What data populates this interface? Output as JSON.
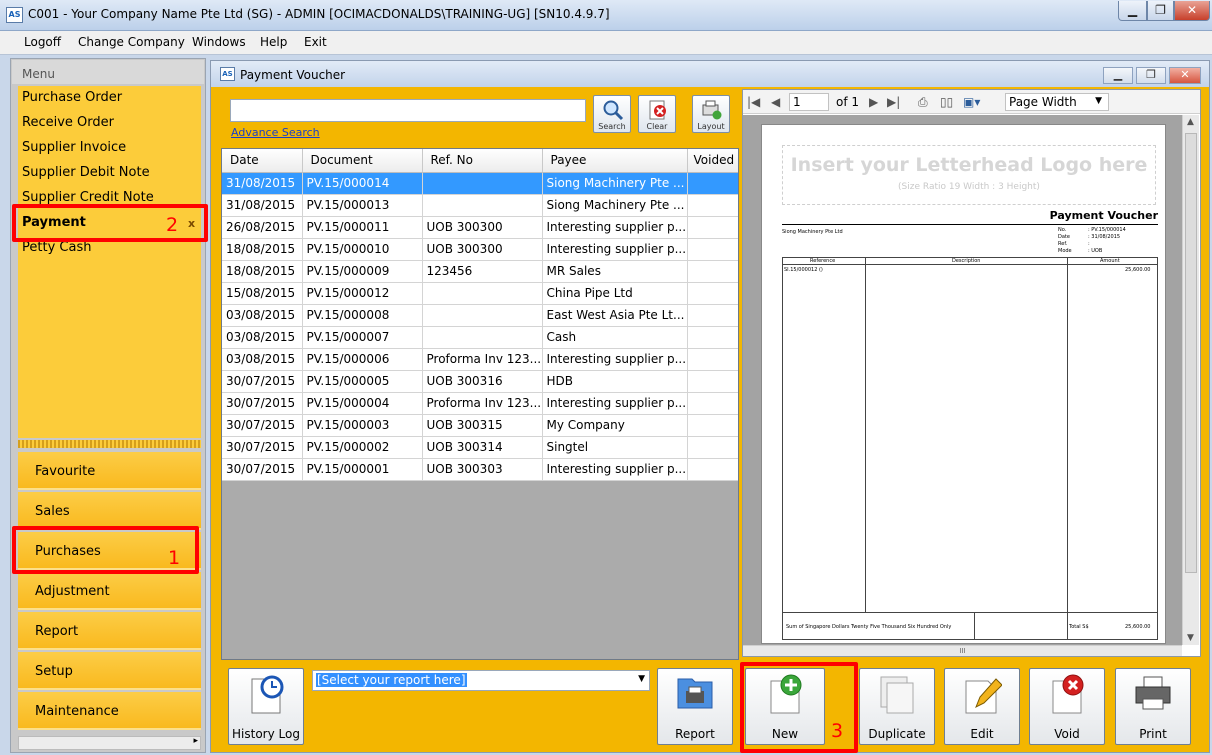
{
  "window": {
    "title": "C001 - Your Company Name Pte Ltd (SG) - ADMIN [OCIMACDONALDS\\TRAINING-UG] [SN10.4.9.7]",
    "icon": "AS"
  },
  "menubar": [
    "Logoff",
    "Change Company",
    "Windows",
    "Help",
    "Exit"
  ],
  "sidebar": {
    "header": "Menu",
    "items": [
      "Purchase Order",
      "Receive Order",
      "Supplier Invoice",
      "Supplier Debit Note",
      "Supplier Credit Note",
      "Payment",
      "Petty Cash"
    ],
    "active_close": "x",
    "categories": [
      "Favourite",
      "Sales",
      "Purchases",
      "Adjustment",
      "Report",
      "Setup",
      "Maintenance"
    ],
    "scroll_glyph": "▸"
  },
  "doc": {
    "title": "Payment Voucher",
    "icon": "AS",
    "advance_search": "Advance Search",
    "buttons": {
      "search": "Search",
      "clear": "Clear",
      "layout": "Layout"
    }
  },
  "grid": {
    "columns": [
      "Date",
      "Document",
      "Ref. No",
      "Payee",
      "Voided"
    ],
    "rows": [
      [
        "31/08/2015",
        "PV.15/000014",
        "",
        "Siong Machinery Pte ...",
        ""
      ],
      [
        "31/08/2015",
        "PV.15/000013",
        "",
        "Siong Machinery Pte ...",
        ""
      ],
      [
        "26/08/2015",
        "PV.15/000011",
        "UOB 300300",
        "Interesting supplier p...",
        ""
      ],
      [
        "18/08/2015",
        "PV.15/000010",
        "UOB 300300",
        "Interesting supplier p...",
        ""
      ],
      [
        "18/08/2015",
        "PV.15/000009",
        "123456",
        "MR Sales",
        ""
      ],
      [
        "15/08/2015",
        "PV.15/000012",
        "",
        "China Pipe Ltd",
        ""
      ],
      [
        "03/08/2015",
        "PV.15/000008",
        "",
        "East West Asia Pte Lt...",
        ""
      ],
      [
        "03/08/2015",
        "PV.15/000007",
        "",
        "Cash",
        ""
      ],
      [
        "03/08/2015",
        "PV.15/000006",
        "Proforma Inv 123...",
        "Interesting supplier p...",
        ""
      ],
      [
        "30/07/2015",
        "PV.15/000005",
        "UOB 300316",
        "HDB",
        ""
      ],
      [
        "30/07/2015",
        "PV.15/000004",
        "Proforma Inv 123...",
        "Interesting supplier p...",
        ""
      ],
      [
        "30/07/2015",
        "PV.15/000003",
        "UOB 300315",
        "My Company",
        ""
      ],
      [
        "30/07/2015",
        "PV.15/000002",
        "UOB 300314",
        "Singtel",
        ""
      ],
      [
        "30/07/2015",
        "PV.15/000001",
        "UOB 300303",
        "Interesting supplier p...",
        ""
      ]
    ],
    "selected_index": 0
  },
  "preview": {
    "page": "1",
    "of": "of 1",
    "zoom": "Page Width",
    "hscroll_grip": "III",
    "letterhead": "Insert your Letterhead Logo here",
    "letterhead_note": "(Size Ratio 19 Width : 3 Height)",
    "heading": "Payment Voucher",
    "company": "Siong Machinery Pte Ltd",
    "meta_labels": [
      "No.",
      "Date",
      "Ref.",
      "Mode"
    ],
    "meta_values": [
      ": PV.15/000014",
      ": 31/08/2015",
      ":",
      ": UOB"
    ],
    "table_headers": [
      "Reference",
      "Description",
      "Amount"
    ],
    "row_ref": "SI.15/000012 ()",
    "row_amount": "25,600.00",
    "words": "Sum of Singapore Dollars Twenty Five Thousand Six Hundred Only",
    "total_label": "Total S$",
    "total_value": "25,600.00"
  },
  "bottom": {
    "history_log": "History Log",
    "report_placeholder": "[Select your report here]",
    "report": "Report",
    "new": "New",
    "duplicate": "Duplicate",
    "edit": "Edit",
    "void": "Void",
    "print": "Print"
  },
  "annotations": [
    "1",
    "2",
    "3"
  ],
  "colors": {
    "accent": "#fccc3a",
    "highlight": "#ff0000",
    "selection": "#3399ff"
  }
}
